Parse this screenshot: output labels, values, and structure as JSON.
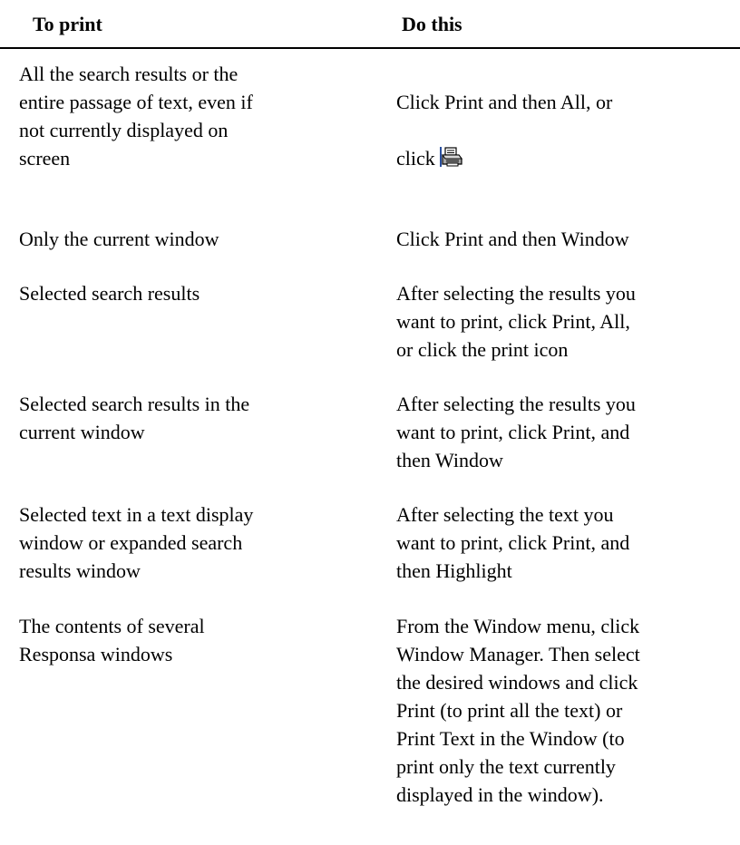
{
  "table": {
    "headers": {
      "left": "To print",
      "right": "Do this"
    },
    "rows": [
      {
        "left": "All the search results or the\nentire passage of text, even if\nnot currently displayed on\nscreen",
        "right_line1": "Click Print and then All, or",
        "right_line2": "click",
        "icon": "printer-icon"
      },
      {
        "left": "Only the current window",
        "right": "Click Print and then Window"
      },
      {
        "left": "Selected search results",
        "right": "After selecting the results you\nwant to print, click Print, All,\nor click the print icon"
      },
      {
        "left": "Selected search results in the\ncurrent window",
        "right": "After selecting the results you\nwant to print, click Print, and\nthen Window"
      },
      {
        "left": "Selected text in a text display\nwindow or expanded search\nresults window",
        "right": "After selecting the text you\nwant to print, click Print, and\nthen Highlight"
      },
      {
        "left": "The contents of several\nResponsa windows",
        "right": "From the Window menu, click\nWindow Manager. Then select\nthe desired windows and click\nPrint (to print all the text) or\nPrint Text in the Window (to\nprint only the text currently\ndisplayed in the window)."
      }
    ]
  }
}
